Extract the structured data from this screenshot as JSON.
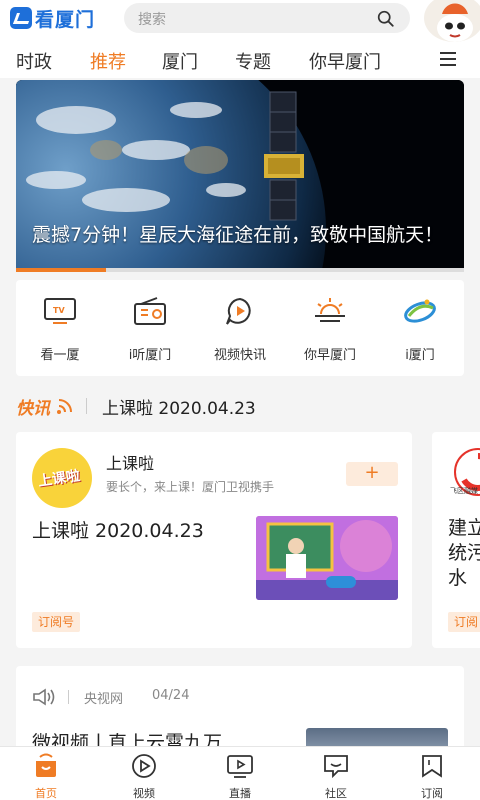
{
  "header": {
    "brand": "看厦门",
    "search_placeholder": "搜索"
  },
  "tabs": [
    {
      "label": "时政",
      "active": false
    },
    {
      "label": "推荐",
      "active": true
    },
    {
      "label": "厦门",
      "active": false
    },
    {
      "label": "专题",
      "active": false
    },
    {
      "label": "你早厦门",
      "active": false
    }
  ],
  "banner": {
    "caption": "震撼7分钟！星辰大海征途在前，致敬中国航天！",
    "progress": 0.2
  },
  "quick_entries": [
    {
      "label": "看一厦",
      "icon": "tv-icon"
    },
    {
      "label": "i听厦门",
      "icon": "radio-icon"
    },
    {
      "label": "视频快讯",
      "icon": "play-bubble-icon"
    },
    {
      "label": "你早厦门",
      "icon": "sunrise-icon"
    },
    {
      "label": "i厦门",
      "icon": "i-xiamen-logo-icon"
    }
  ],
  "news_flash": {
    "tag": "快讯",
    "text": "上课啦 2020.04.23"
  },
  "cards": [
    {
      "logo_text": "上课啦",
      "name": "上课啦",
      "desc": "要长个，来上课！厦门卫视携手",
      "follow": "+",
      "headline": "上课啦 2020.04.23",
      "tag": "订阅号"
    },
    {
      "logo_sub": "飞区融媒",
      "headline_partial": "建立统污水",
      "tag": "订阅"
    }
  ],
  "article": {
    "source": "央视网",
    "date": "04/24",
    "title": "微视频丨直上云霄九万"
  },
  "bottom_nav": [
    {
      "label": "首页",
      "icon": "home-icon",
      "active": true
    },
    {
      "label": "视频",
      "icon": "video-icon",
      "active": false
    },
    {
      "label": "直播",
      "icon": "live-tv-icon",
      "active": false
    },
    {
      "label": "社区",
      "icon": "community-icon",
      "active": false
    },
    {
      "label": "订阅",
      "icon": "subscribe-icon",
      "active": false
    }
  ],
  "colors": {
    "accent": "#ef7c25",
    "brand": "#1e6fd9"
  }
}
